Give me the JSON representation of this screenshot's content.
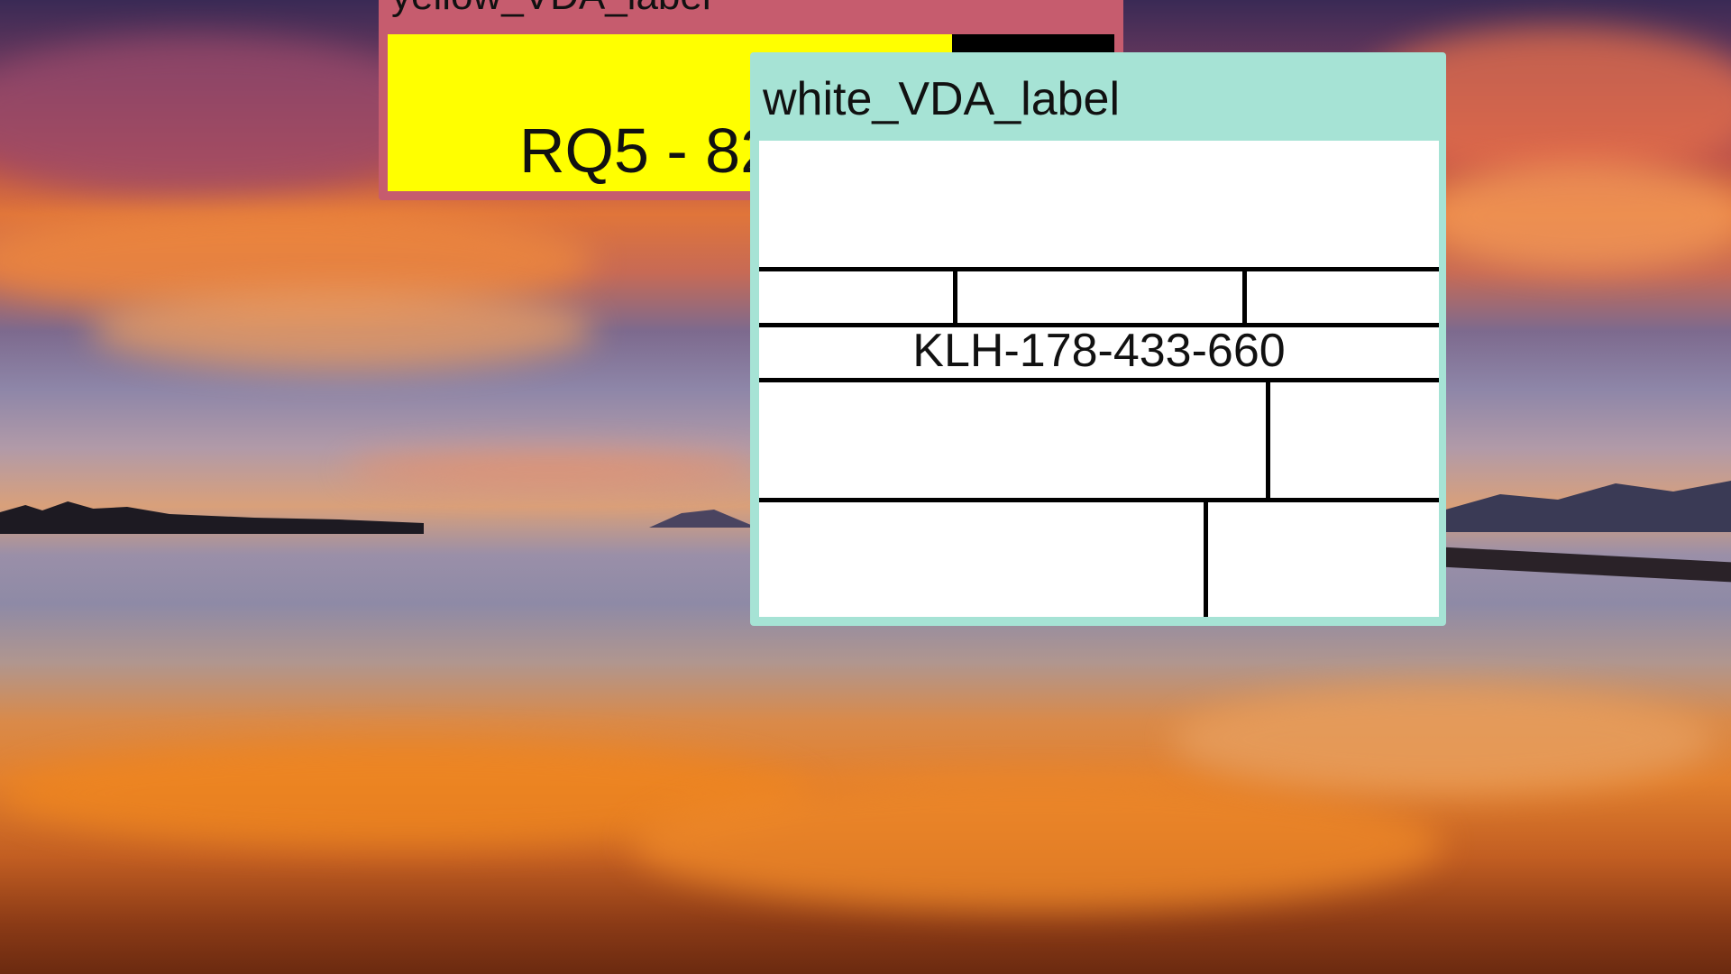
{
  "desktop": {
    "wallpaper": "sunset-lake"
  },
  "yellow_window": {
    "title": "yellow_VDA_label",
    "body_text": "RQ5 - 82",
    "colors": {
      "frame": "#c65c6e",
      "body": "#ffff00"
    }
  },
  "white_window": {
    "title": "white_VDA_label",
    "code": "KLH-178-433-660",
    "colors": {
      "frame": "#a6e3d5",
      "body": "#ffffff"
    }
  }
}
